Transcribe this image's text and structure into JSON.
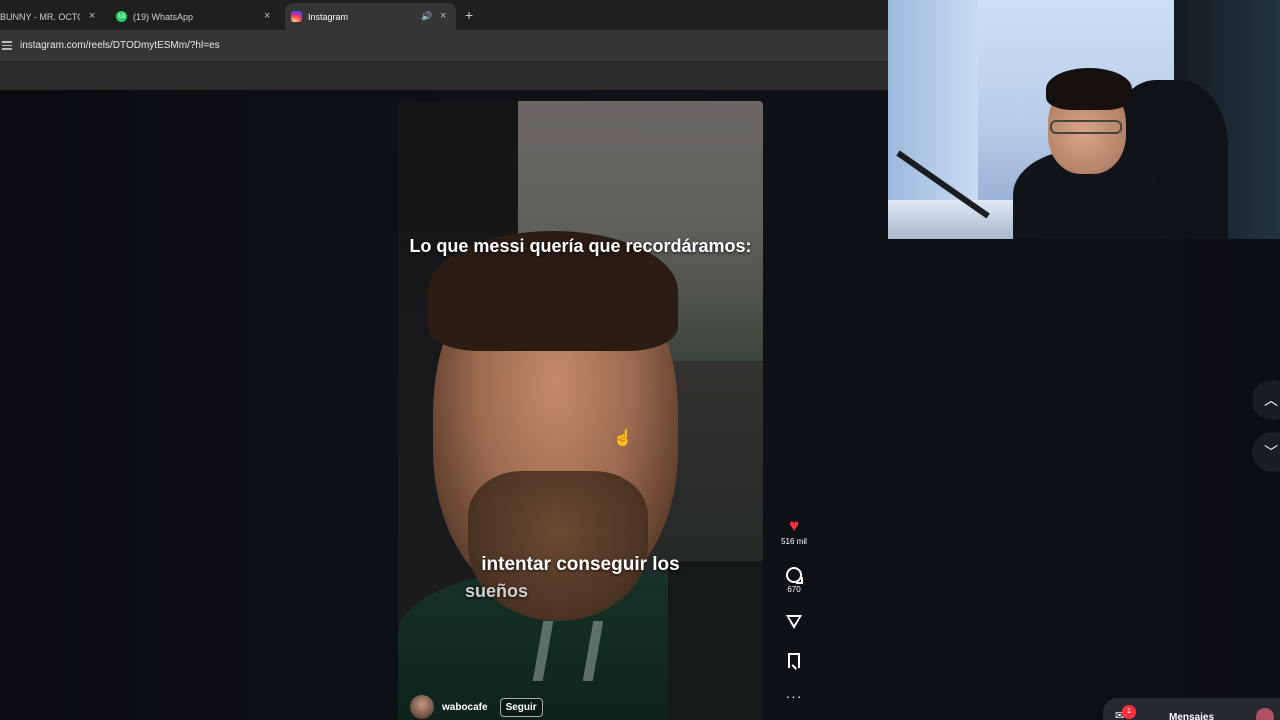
{
  "browser": {
    "tabs": [
      {
        "title": "BUNNY - MR. OCTOBER",
        "close": "×"
      },
      {
        "title": "(19) WhatsApp",
        "badge": "19",
        "close": "×"
      },
      {
        "title": "Instagram",
        "speaker": "🔊",
        "close": "×",
        "active": true
      }
    ],
    "new_tab": "+",
    "url": "instagram.com/reels/DTODmytESMm/?hl=es"
  },
  "reel": {
    "caption_top": "Lo que messi quería que recordáramos:",
    "caption_bottom_line1": "intentar conseguir los",
    "caption_bottom_line2": "sueños",
    "username": "wabocafe",
    "follow_label": "Seguir"
  },
  "actions": {
    "like_count": "516 mil",
    "comment_count": "670",
    "more": "···",
    "heart_color": "#ff3040"
  },
  "nav": {
    "up": "︿",
    "down": "﹀"
  },
  "messages": {
    "label": "Mensajes",
    "badge": "1"
  },
  "icons": [
    "site-info-icon",
    "instagram-favicon",
    "whatsapp-favicon",
    "speaker-icon",
    "heart-icon",
    "comment-icon",
    "send-icon",
    "save-icon",
    "more-icon",
    "chevron-up-icon",
    "chevron-down-icon",
    "messages-icon"
  ]
}
